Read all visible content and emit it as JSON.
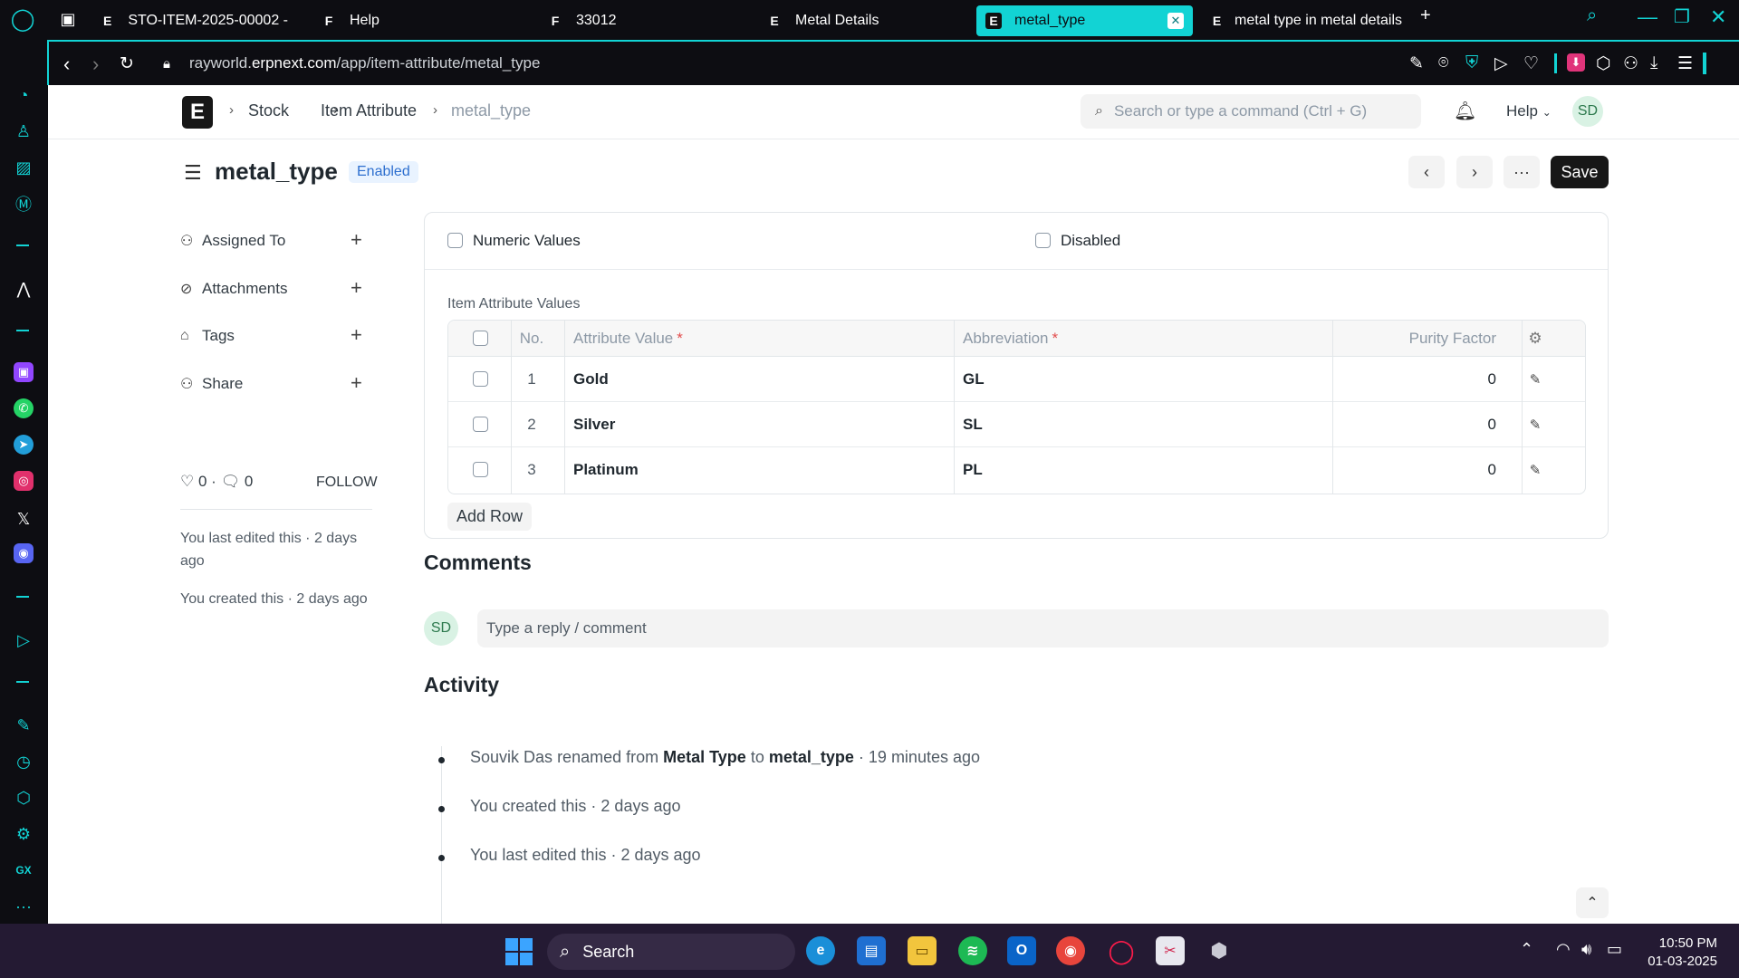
{
  "browser": {
    "tabs": [
      {
        "label": "STO-ITEM-2025-00002 -",
        "favicon": "E"
      },
      {
        "label": "Help",
        "favicon": "F"
      },
      {
        "label": "33012",
        "favicon": "F"
      },
      {
        "label": "Metal Details",
        "favicon": "E"
      },
      {
        "label": "metal_type",
        "favicon": "E",
        "active": true
      },
      {
        "label": "metal type in metal details",
        "favicon": "E"
      }
    ],
    "url_prefix": "rayworld.",
    "url_domain": "erpnext.com",
    "url_path": "/app/item-attribute/metal_type",
    "accent": "#12d3d4"
  },
  "navbar": {
    "logo": "E",
    "breadcrumbs": [
      "Stock",
      "Item Attribute",
      "metal_type"
    ],
    "search_placeholder": "Search or type a command (Ctrl + G)",
    "help_label": "Help",
    "user_initials": "SD"
  },
  "doc": {
    "title": "metal_type",
    "status": "Enabled",
    "save_label": "Save",
    "more_label": "···"
  },
  "sidebar": {
    "items": [
      "Assigned To",
      "Attachments",
      "Tags",
      "Share"
    ],
    "likes": "0",
    "comments": "0",
    "follow_label": "FOLLOW",
    "last_edited": "You last edited this · 2 days ago",
    "created": "You created this · 2 days ago"
  },
  "form": {
    "numeric_values_label": "Numeric Values",
    "disabled_label": "Disabled",
    "section_label": "Item Attribute Values",
    "columns": {
      "no": "No.",
      "attribute_value": "Attribute Value",
      "abbreviation": "Abbreviation",
      "purity_factor": "Purity Factor"
    },
    "rows": [
      {
        "no": "1",
        "value": "Gold",
        "abbr": "GL",
        "purity": "0"
      },
      {
        "no": "2",
        "value": "Silver",
        "abbr": "SL",
        "purity": "0"
      },
      {
        "no": "3",
        "value": "Platinum",
        "abbr": "PL",
        "purity": "0"
      }
    ],
    "add_row_label": "Add Row"
  },
  "comments": {
    "heading": "Comments",
    "placeholder": "Type a reply / comment",
    "user_initials": "SD"
  },
  "activity": {
    "heading": "Activity",
    "rename": {
      "actor": "Souvik Das",
      "text1": "renamed from",
      "from": "Metal Type",
      "text2": "to",
      "to": "metal_type",
      "time": "· 19 minutes ago"
    },
    "created": "You created this · 2 days ago",
    "edited": "You last edited this · 2 days ago"
  },
  "taskbar": {
    "search_label": "Search",
    "time": "10:50 PM",
    "date": "01-03-2025"
  }
}
